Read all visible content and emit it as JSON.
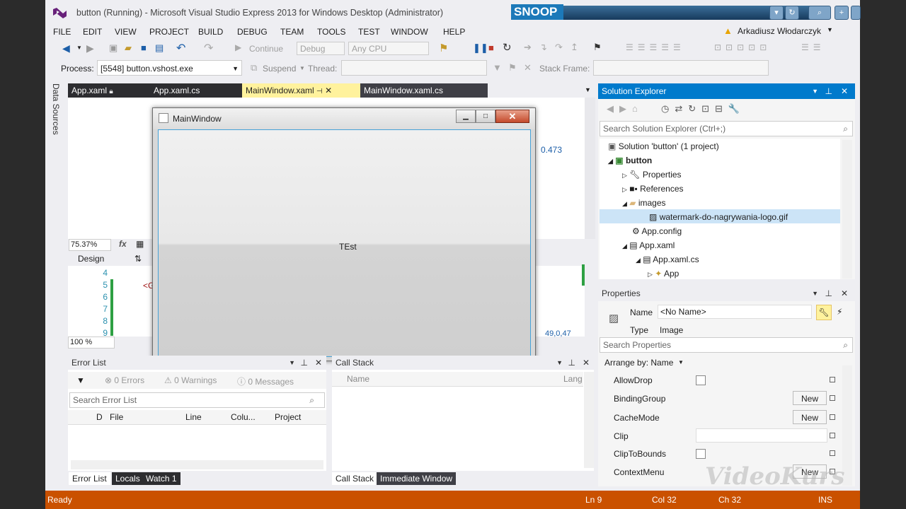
{
  "window_title": "button (Running) - Microsoft Visual Studio Express 2013 for Windows Desktop (Administrator)",
  "snoop_label": "SNOOP",
  "menu": [
    "FILE",
    "EDIT",
    "VIEW",
    "PROJECT",
    "BUILD",
    "DEBUG",
    "TEAM",
    "TOOLS",
    "TEST",
    "WINDOW",
    "HELP"
  ],
  "user_name": "Arkadiusz Włodarczyk",
  "toolbar": {
    "continue_label": "Continue",
    "config_value": "Debug",
    "platform_value": "Any CPU"
  },
  "process_bar": {
    "process_label": "Process:",
    "process_value": "[5548] button.vshost.exe",
    "suspend_label": "Suspend",
    "thread_label": "Thread:",
    "stack_frame_label": "Stack Frame:"
  },
  "left_sidebar_label": "Data Sources",
  "doc_tabs": [
    {
      "label": "App.xaml",
      "active": false
    },
    {
      "label": "App.xaml.cs",
      "active": false
    },
    {
      "label": "MainWindow.xaml",
      "active": true
    },
    {
      "label": "MainWindow.xaml.cs",
      "active": false
    }
  ],
  "editor": {
    "zoom_value": "75.37%",
    "value_label": "0.473",
    "design_tab": "Design",
    "line_numbers": [
      "4",
      "5",
      "6",
      "7",
      "8",
      "9"
    ],
    "code_line": "<G",
    "zoom_bottom": "100 %",
    "bottom_value": "49,0,47"
  },
  "app_window": {
    "title": "MainWindow",
    "button_text": "TEst"
  },
  "solution_explorer": {
    "title": "Solution Explorer",
    "search_placeholder": "Search Solution Explorer (Ctrl+;)",
    "items": [
      {
        "label": "Solution 'button' (1 project)",
        "level": 0,
        "bold": false
      },
      {
        "label": "button",
        "level": 1,
        "bold": true
      },
      {
        "label": "Properties",
        "level": 2,
        "bold": false
      },
      {
        "label": "References",
        "level": 2,
        "bold": false
      },
      {
        "label": "images",
        "level": 2,
        "bold": false
      },
      {
        "label": "watermark-do-nagrywania-logo.gif",
        "level": 3,
        "bold": false
      },
      {
        "label": "App.config",
        "level": 2,
        "bold": false
      },
      {
        "label": "App.xaml",
        "level": 2,
        "bold": false
      },
      {
        "label": "App.xaml.cs",
        "level": 3,
        "bold": false
      },
      {
        "label": "App",
        "level": 4,
        "bold": false
      }
    ]
  },
  "properties": {
    "title": "Properties",
    "name_label": "Name",
    "name_value": "<No Name>",
    "type_label": "Type",
    "type_value": "Image",
    "search_placeholder": "Search Properties",
    "arrange_label": "Arrange by: Name",
    "new_label": "New",
    "rows": [
      "AllowDrop",
      "BindingGroup",
      "CacheMode",
      "Clip",
      "ClipToBounds",
      "ContextMenu"
    ]
  },
  "error_list": {
    "title": "Error List",
    "errors": "0 Errors",
    "warnings": "0 Warnings",
    "messages": "0 Messages",
    "search_placeholder": "Search Error List",
    "columns": [
      "D",
      "File",
      "Line",
      "Colu...",
      "Project"
    ],
    "tabs": [
      "Error List",
      "Locals",
      "Watch 1"
    ]
  },
  "call_stack": {
    "title": "Call Stack",
    "col_name": "Name",
    "col_lang": "Lang",
    "tabs": [
      "Call Stack",
      "Immediate Window"
    ]
  },
  "status": {
    "ready": "Ready",
    "ln": "Ln 9",
    "col": "Col 32",
    "ch": "Ch 32",
    "ins": "INS"
  },
  "watermark": "VideoKurs"
}
